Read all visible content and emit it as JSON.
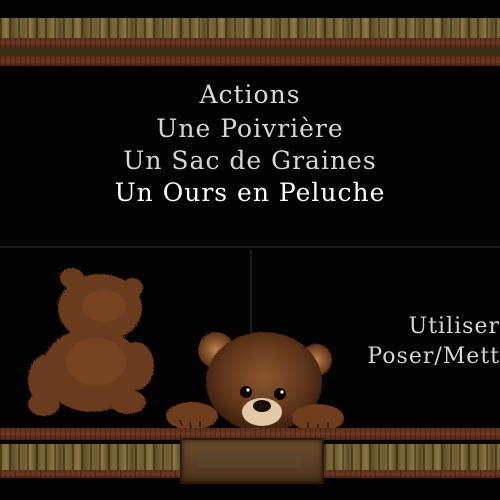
{
  "menu": {
    "title": "Actions",
    "items": [
      "Une Poivrière",
      "Un Sac de Graines",
      "Un Ours en Peluche"
    ]
  },
  "side_actions": {
    "use": "Utiliser",
    "place": "Poser/Mett"
  },
  "colors": {
    "background": "#030303",
    "text": "#d6d6d6",
    "highlight_text": "#ffffff",
    "border_gold": "#8f7a45",
    "border_brown": "#6e3a22",
    "bear_brown": "#6b3a1e"
  },
  "icons": {
    "shadow_bear": "teddy-bear-silhouette",
    "teddy_bear": "teddy-bear"
  }
}
